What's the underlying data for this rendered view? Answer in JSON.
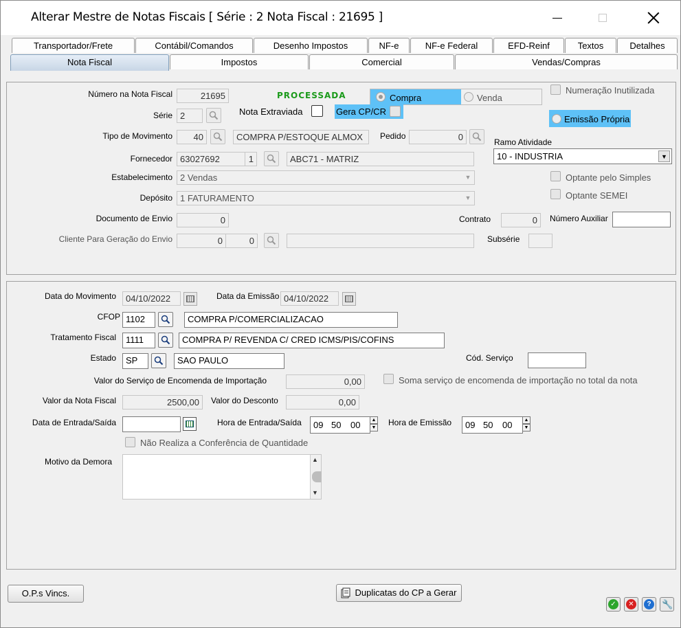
{
  "window": {
    "title": "Alterar Mestre de Notas Fiscais [ Série : 2   Nota Fiscal : 21695 ]"
  },
  "tabs_top": [
    "Transportador/Frete",
    "Contábil/Comandos",
    "Desenho Impostos",
    "NF-e",
    "NF-e Federal",
    "EFD-Reinf",
    "Textos",
    "Detalhes"
  ],
  "tabs_bottom": [
    "Nota Fiscal",
    "Impostos",
    "Comercial",
    "Vendas/Compras"
  ],
  "nota": {
    "numero_label": "Número na Nota Fiscal",
    "numero": "21695",
    "status": "PROCESSADA",
    "compra_label": "Compra",
    "venda_label": "Venda",
    "numeracao_inutilizada_label": "Numeração Inutilizada",
    "serie_label": "Série",
    "serie": "2",
    "nota_extraviada_label": "Nota Extraviada",
    "gera_cpcr_label": "Gera CP/CR",
    "emissao_propria_label": "Emissão Própria",
    "tipo_mov_label": "Tipo de Movimento",
    "tipo_mov_codigo": "40",
    "tipo_mov_desc": "COMPRA P/ESTOQUE ALMOX",
    "pedido_label": "Pedido",
    "pedido": "0",
    "ramo_label": "Ramo Atividade",
    "ramo": "10 - INDUSTRIA",
    "fornecedor_label": "Fornecedor",
    "fornecedor_codigo": "63027692",
    "fornecedor_loja": "1",
    "fornecedor_nome": "ABC71 - MATRIZ",
    "estabelecimento_label": "Estabelecimento",
    "estabelecimento": "2 Vendas",
    "optante_simples_label": "Optante pelo Simples",
    "deposito_label": "Depósito",
    "deposito": "1 FATURAMENTO",
    "optante_semei_label": "Optante SEMEI",
    "doc_envio_label": "Documento de Envio",
    "doc_envio": "0",
    "contrato_label": "Contrato",
    "contrato": "0",
    "num_auxiliar_label": "Número Auxiliar",
    "num_auxiliar": "",
    "cliente_envio_label": "Cliente Para Geração do Envio",
    "cliente_envio_a": "0",
    "cliente_envio_b": "0",
    "subserie_label": "Subsérie",
    "subserie": ""
  },
  "mov": {
    "data_mov_label": "Data do Movimento",
    "data_mov": "04/10/2022",
    "data_emissao_label": "Data da Emissão",
    "data_emissao": "04/10/2022",
    "cfop_label": "CFOP",
    "cfop": "1102",
    "cfop_desc": "COMPRA P/COMERCIALIZACAO",
    "tratamento_label": "Tratamento Fiscal",
    "tratamento": "1111",
    "tratamento_desc": "COMPRA P/ REVENDA  C/ CRED ICMS/PIS/COFINS",
    "estado_label": "Estado",
    "estado": "SP",
    "estado_desc": "SAO PAULO",
    "cod_servico_label": "Cód. Serviço",
    "cod_servico": "",
    "valor_servico_label": "Valor do Serviço de Encomenda de Importação",
    "valor_servico": "0,00",
    "soma_servico_label": "Soma serviço de encomenda de importação no total da nota",
    "valor_nota_label": "Valor da Nota Fiscal",
    "valor_nota": "2500,00",
    "valor_desconto_label": "Valor do Desconto",
    "valor_desconto": "0,00",
    "data_entrada_label": "Data de Entrada/Saída",
    "data_entrada": "",
    "hora_entrada_label": "Hora de Entrada/Saída",
    "hora_entrada_h": "09",
    "hora_entrada_m": "50",
    "hora_entrada_s": "00",
    "hora_emissao_label": "Hora de Emissão",
    "hora_emissao_h": "09",
    "hora_emissao_m": "50",
    "hora_emissao_s": "00",
    "nao_conferencia_label": "Não Realiza a Conferência de Quantidade",
    "motivo_label": "Motivo da Demora",
    "motivo": ""
  },
  "footer": {
    "ops_label": "O.P.s Vincs.",
    "duplicatas_label": "Duplicatas do CP a Gerar"
  },
  "colors": {
    "highlight": "#5ec1f7",
    "status_green": "#1a9a1a"
  }
}
